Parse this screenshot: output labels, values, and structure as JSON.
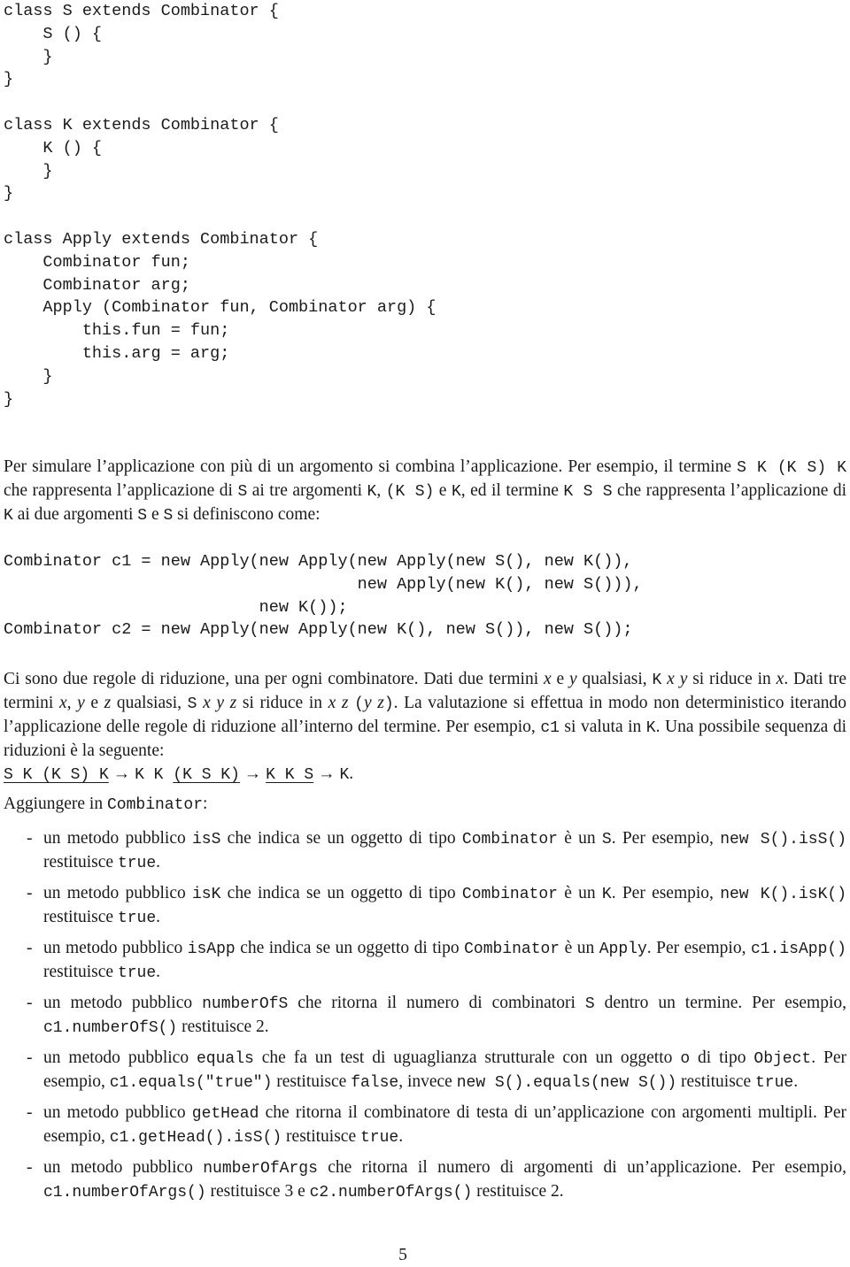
{
  "code_classes": {
    "lines": [
      "class S extends Combinator {",
      "    S () {",
      "    }",
      "}",
      "",
      "class K extends Combinator {",
      "    K () {",
      "    }",
      "}",
      "",
      "class Apply extends Combinator {",
      "    Combinator fun;",
      "    Combinator arg;",
      "    Apply (Combinator fun, Combinator arg) {",
      "        this.fun = fun;",
      "        this.arg = arg;",
      "    }",
      "}"
    ]
  },
  "intro": {
    "t1": "Per simulare l’applicazione con più di un argomento si combina l’applicazione. Per esempio, il termine ",
    "c1": "S K (K S) K",
    "t2": " che rappresenta l’applicazione di ",
    "c2": "S",
    "t3": " ai tre argomenti ",
    "c3": "K",
    "t4": ", ",
    "c4": "(K S)",
    "t5": " e ",
    "c5": "K",
    "t6": ", ed il termine ",
    "c6": "K S S",
    "t7": " che rappresenta l’applicazione di ",
    "c7": "K",
    "t8": " ai due argomenti ",
    "c8": "S",
    "t9": " e ",
    "c9": "S",
    "t10": " si definiscono come:"
  },
  "code_example": {
    "lines": [
      "Combinator c1 = new Apply(new Apply(new Apply(new S(), new K()),",
      "                                    new Apply(new K(), new S())),",
      "                          new K());",
      "Combinator c2 = new Apply(new Apply(new K(), new S()), new S());"
    ]
  },
  "rules": {
    "t1": "Ci sono due regole di riduzione, una per ogni combinatore. Dati due termini ",
    "x": "x",
    "t2": " e ",
    "y": "y",
    "t3": " qualsiasi, ",
    "c_kxy_k": "K",
    "t4": " si riduce in ",
    "t5": ". Dati tre termini ",
    "t6": ", ",
    "t7": " e ",
    "z": "z",
    "t8": " qualsiasi, ",
    "c_s": "S",
    "t9": " si riduce in ",
    "paren_open": "(",
    "paren_close": ")",
    "t10": ". La valutazione si effettua in modo non deterministico iterando l’applicazione delle regole di riduzione all’interno del termine. Per esempio, ",
    "c_c1": "c1",
    "t11": " si valuta in ",
    "c_k": "K",
    "t12": ". Una possibile sequenza di riduzioni è la seguente:",
    "sequence": {
      "step1": "S K (K S) K",
      "arrow": "→",
      "step2_prefix": "K K ",
      "step2_redex": "(K S K)",
      "step3": "K K S",
      "result": "K",
      "end": "."
    }
  },
  "task": {
    "t1": "Aggiungere in ",
    "c1": "Combinator",
    "t2": ":"
  },
  "methods": [
    {
      "bullet": "-",
      "parts": [
        {
          "t": "un metodo pubblico "
        },
        {
          "c": "isS"
        },
        {
          "t": " che indica se un oggetto di tipo "
        },
        {
          "c": "Combinator"
        },
        {
          "t": " è un "
        },
        {
          "c": "S"
        },
        {
          "t": ". Per esempio, "
        },
        {
          "c": "new S().isS()"
        },
        {
          "t": " restituisce "
        },
        {
          "c": "true"
        },
        {
          "t": "."
        }
      ]
    },
    {
      "bullet": "-",
      "parts": [
        {
          "t": "un metodo pubblico "
        },
        {
          "c": "isK"
        },
        {
          "t": " che indica se un oggetto di tipo "
        },
        {
          "c": "Combinator"
        },
        {
          "t": " è un "
        },
        {
          "c": "K"
        },
        {
          "t": ". Per esempio, "
        },
        {
          "c": "new K().isK()"
        },
        {
          "t": " restituisce "
        },
        {
          "c": "true"
        },
        {
          "t": "."
        }
      ]
    },
    {
      "bullet": "-",
      "parts": [
        {
          "t": "un metodo pubblico "
        },
        {
          "c": "isApp"
        },
        {
          "t": " che indica se un oggetto di tipo "
        },
        {
          "c": "Combinator"
        },
        {
          "t": " è un "
        },
        {
          "c": "Apply"
        },
        {
          "t": ". Per esempio, "
        },
        {
          "c": "c1.isApp()"
        },
        {
          "t": " restituisce "
        },
        {
          "c": "true"
        },
        {
          "t": "."
        }
      ]
    },
    {
      "bullet": "-",
      "parts": [
        {
          "t": "un metodo pubblico "
        },
        {
          "c": "numberOfS"
        },
        {
          "t": " che ritorna il numero di combinatori "
        },
        {
          "c": "S"
        },
        {
          "t": " dentro un termine. Per esempio, "
        },
        {
          "c": "c1.numberOfS()"
        },
        {
          "t": " restituisce 2."
        }
      ]
    },
    {
      "bullet": "-",
      "parts": [
        {
          "t": "un metodo pubblico "
        },
        {
          "c": "equals"
        },
        {
          "t": " che fa un test di uguaglianza strutturale con un oggetto "
        },
        {
          "c": "o"
        },
        {
          "t": " di tipo "
        },
        {
          "c": "Object"
        },
        {
          "t": ". Per esempio, "
        },
        {
          "c": "c1.equals(\"true\")"
        },
        {
          "t": " restituisce "
        },
        {
          "c": "false"
        },
        {
          "t": ", invece "
        },
        {
          "c": "new S().equals(new S())"
        },
        {
          "t": " restituisce "
        },
        {
          "c": "true"
        },
        {
          "t": "."
        }
      ]
    },
    {
      "bullet": "-",
      "parts": [
        {
          "t": "un metodo pubblico "
        },
        {
          "c": "getHead"
        },
        {
          "t": " che ritorna il combinatore di testa di un’applicazione con argomenti multipli. Per esempio, "
        },
        {
          "c": "c1.getHead().isS()"
        },
        {
          "t": " restituisce "
        },
        {
          "c": "true"
        },
        {
          "t": "."
        }
      ]
    },
    {
      "bullet": "-",
      "parts": [
        {
          "t": "un metodo pubblico "
        },
        {
          "c": "numberOfArgs"
        },
        {
          "t": " che ritorna il numero di argomenti di un’applicazione. Per esempio, "
        },
        {
          "c": "c1.numberOfArgs()"
        },
        {
          "t": " restituisce 3 e "
        },
        {
          "c": "c2.numberOfArgs()"
        },
        {
          "t": " restituisce 2."
        }
      ]
    }
  ],
  "page_number": "5"
}
